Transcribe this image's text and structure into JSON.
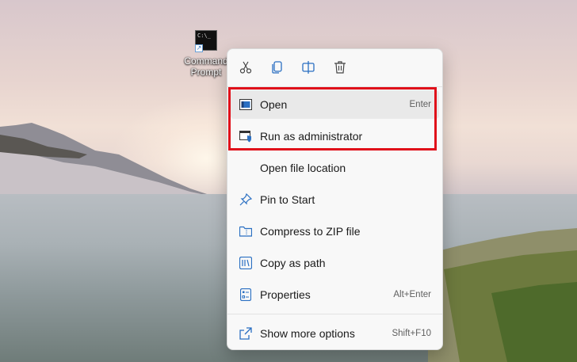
{
  "desktop": {
    "shortcut_label_line1": "Command",
    "shortcut_label_line2": "Prompt",
    "cmd_glyph": "C:\\_"
  },
  "toolbar": {
    "buttons": [
      {
        "icon": "cut-icon"
      },
      {
        "icon": "copy-icon"
      },
      {
        "icon": "rename-icon"
      },
      {
        "icon": "delete-icon"
      }
    ]
  },
  "menu": {
    "items": [
      {
        "label": "Open",
        "shortcut": "Enter",
        "icon": "open-app-icon"
      },
      {
        "label": "Run as administrator",
        "shortcut": "",
        "icon": "shield-window-icon"
      },
      {
        "label": "Open file location",
        "shortcut": "",
        "icon": ""
      },
      {
        "label": "Pin to Start",
        "shortcut": "",
        "icon": "pin-icon"
      },
      {
        "label": "Compress to ZIP file",
        "shortcut": "",
        "icon": "zip-folder-icon"
      },
      {
        "label": "Copy as path",
        "shortcut": "",
        "icon": "copy-path-icon"
      },
      {
        "label": "Properties",
        "shortcut": "Alt+Enter",
        "icon": "properties-icon"
      },
      {
        "label": "Show more options",
        "shortcut": "Shift+F10",
        "icon": "more-options-icon"
      }
    ]
  },
  "colors": {
    "highlight_border": "#e0101a",
    "icon_blue": "#2a6fc2"
  }
}
